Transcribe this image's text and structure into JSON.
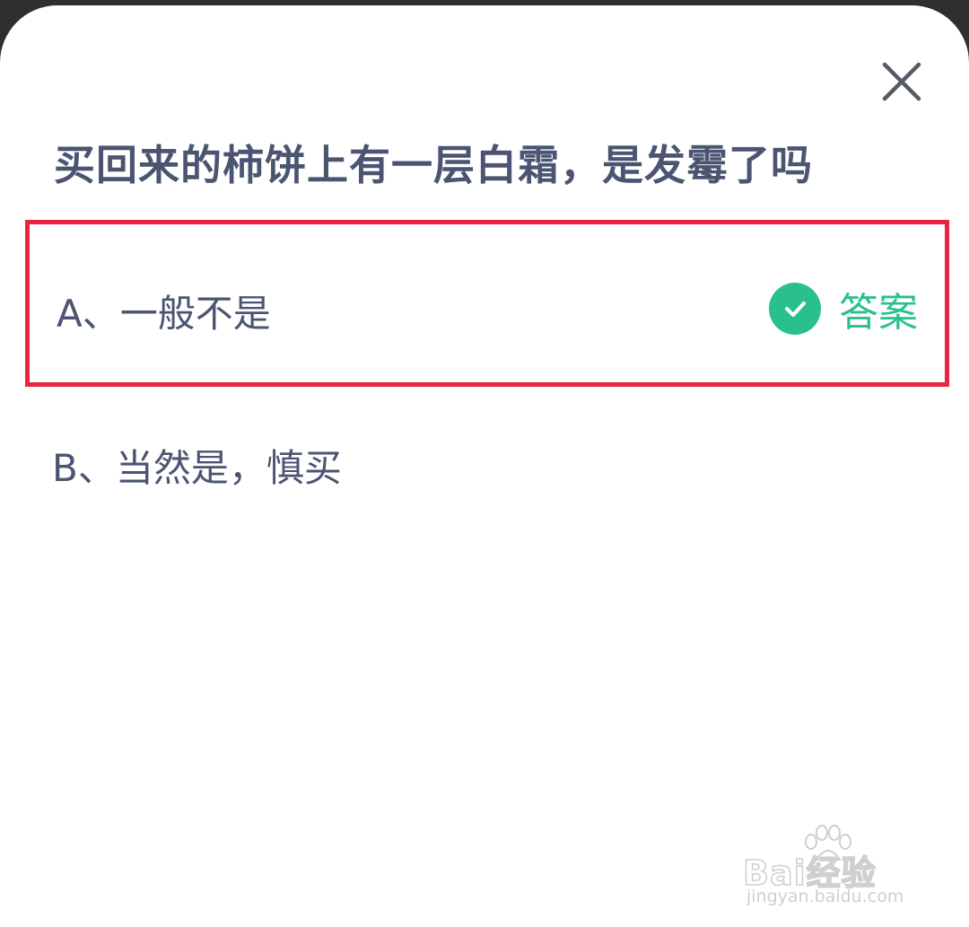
{
  "dialog": {
    "close_icon": "close-icon",
    "question": "买回来的柿饼上有一层白霜，是发霉了吗",
    "options": [
      {
        "label": "A、一般不是",
        "is_answer": true,
        "answer_badge": "答案",
        "badge_icon": "check-circle-icon"
      },
      {
        "label": "B、当然是，慎买",
        "is_answer": false
      }
    ],
    "highlight_color": "#e8253f",
    "answer_color": "#2ac08e"
  },
  "watermark": {
    "brand": "Bai经验",
    "url": "jingyan.baidu.com",
    "icon": "paw-icon"
  }
}
